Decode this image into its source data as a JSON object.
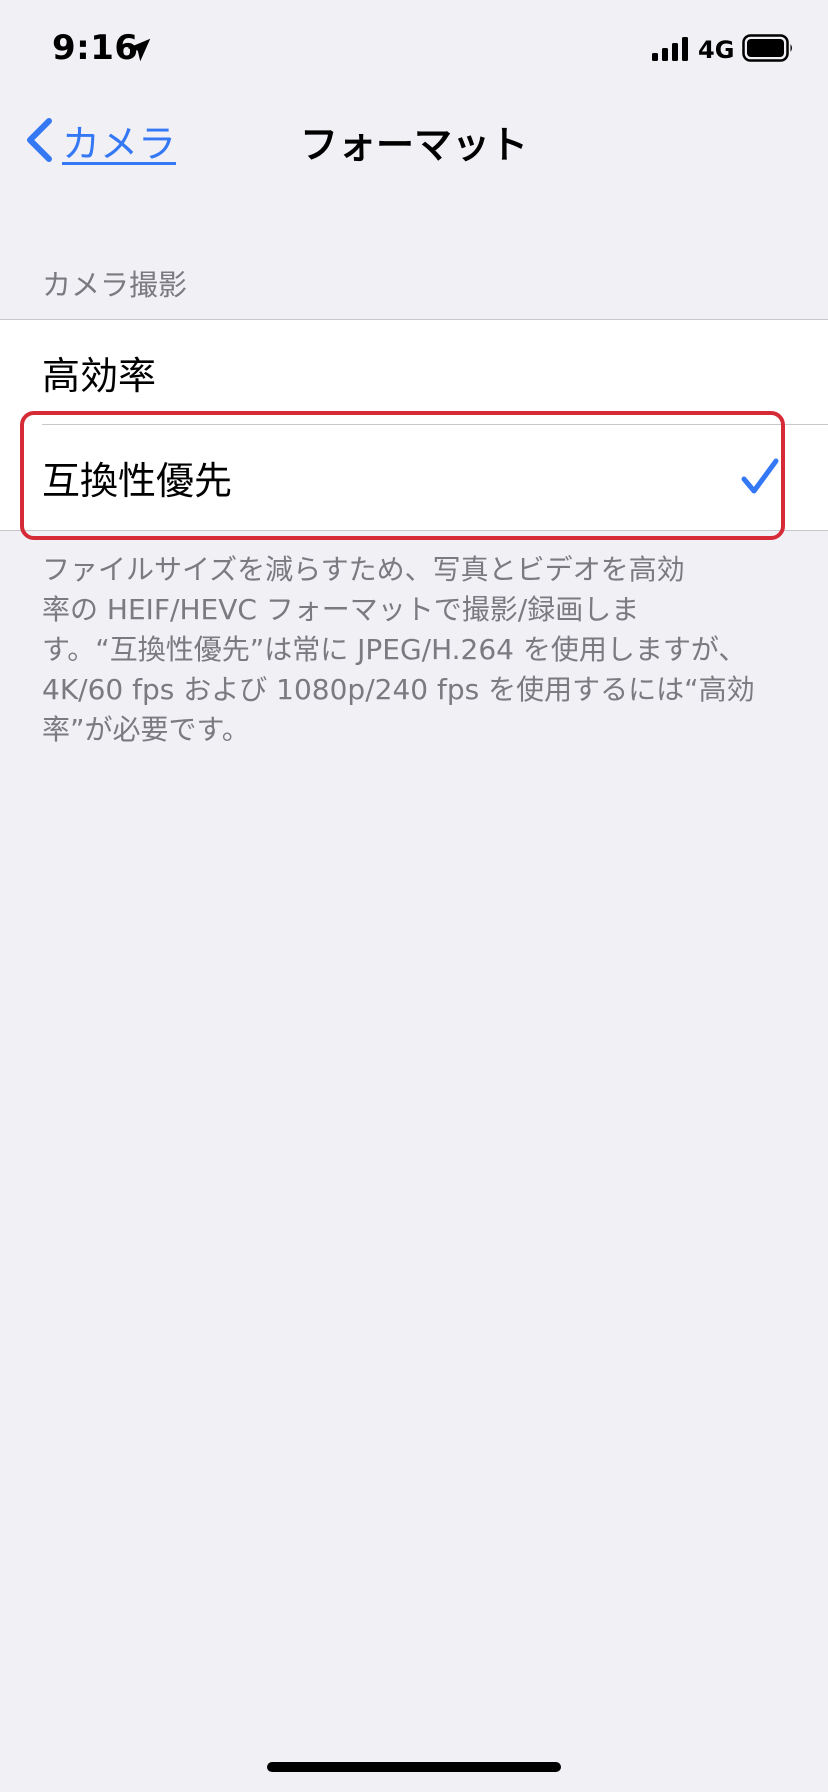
{
  "status_bar": {
    "time": "9:16",
    "network": "4G"
  },
  "nav": {
    "back_label": "カメラ",
    "title": "フォーマット"
  },
  "section": {
    "header": "カメラ撮影",
    "options": [
      {
        "label": "高効率",
        "selected": false
      },
      {
        "label": "互換性優先",
        "selected": true
      }
    ],
    "footer": "ファイルサイズを減らすため、写真とビデオを高効\n率の HEIF/HEVC フォーマットで撮影/録画しま\nす。“互換性優先”は常に JPEG/H.264 を使用しますが、4K/60 fps および 1080p/240 fps を使用するには“高効率”が必要です。"
  },
  "colors": {
    "accent": "#3478f6",
    "highlight": "#d62b36",
    "background": "#f0f0f5"
  }
}
